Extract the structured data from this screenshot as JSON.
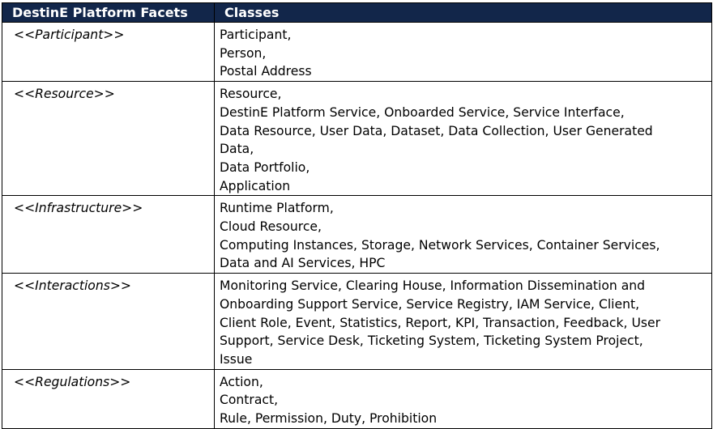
{
  "header": {
    "col1": "DestinE Platform Facets",
    "col2": "Classes"
  },
  "rows": [
    {
      "facet": "<<Participant>>",
      "lines": [
        "Participant,",
        "Person,",
        "Postal Address"
      ]
    },
    {
      "facet": "<<Resource>>",
      "lines": [
        "Resource,",
        "DestinE Platform Service, Onboarded Service, Service Interface,",
        "Data Resource, User Data, Dataset, Data Collection, User Generated",
        "Data,",
        "Data Portfolio,",
        "Application"
      ]
    },
    {
      "facet": "<<Infrastructure>>",
      "lines": [
        "Runtime Platform,",
        "Cloud Resource,",
        "Computing Instances, Storage, Network Services, Container Services,",
        "Data and AI Services, HPC"
      ]
    },
    {
      "facet": "<<Interactions>>",
      "lines": [
        "Monitoring Service, Clearing House, Information Dissemination and",
        "Onboarding Support Service, Service Registry, IAM Service, Client,",
        "Client Role, Event, Statistics, Report, KPI, Transaction, Feedback, User",
        "Support, Service Desk, Ticketing System, Ticketing System Project,",
        "Issue"
      ]
    },
    {
      "facet": "<<Regulations>>",
      "lines": [
        "Action,",
        "Contract,",
        "Rule, Permission, Duty, Prohibition"
      ]
    }
  ]
}
